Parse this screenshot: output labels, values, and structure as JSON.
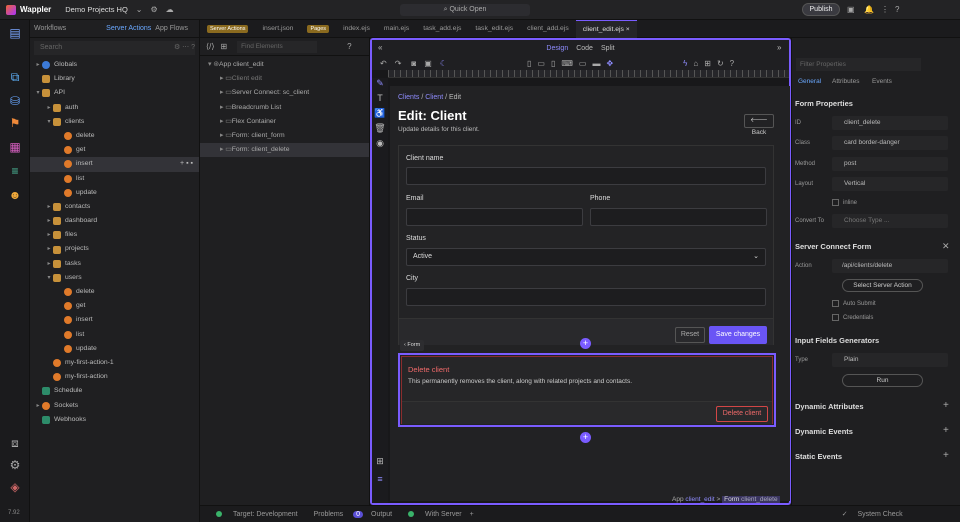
{
  "app": {
    "name": "Wappler",
    "project": "Demo Projects HQ",
    "quick_open": "Quick Open",
    "publish": "Publish"
  },
  "left": {
    "tabs": [
      "Workflows",
      "Server Actions",
      "App Flows"
    ],
    "search_placeholder": "Search",
    "tree": [
      {
        "label": "Globals",
        "depth": 0,
        "icon": "globe",
        "arrow": "right"
      },
      {
        "label": "Library",
        "depth": 0,
        "icon": "folder",
        "arrow": ""
      },
      {
        "label": "API",
        "depth": 0,
        "icon": "folder",
        "arrow": "down"
      },
      {
        "label": "auth",
        "depth": 1,
        "icon": "folder",
        "arrow": "right"
      },
      {
        "label": "clients",
        "depth": 1,
        "icon": "folder",
        "arrow": "down"
      },
      {
        "label": "delete",
        "depth": 2,
        "icon": "sa",
        "arrow": ""
      },
      {
        "label": "get",
        "depth": 2,
        "icon": "sa",
        "arrow": ""
      },
      {
        "label": "insert",
        "depth": 2,
        "icon": "sa",
        "arrow": "",
        "selected": true
      },
      {
        "label": "list",
        "depth": 2,
        "icon": "sa",
        "arrow": ""
      },
      {
        "label": "update",
        "depth": 2,
        "icon": "sa",
        "arrow": ""
      },
      {
        "label": "contacts",
        "depth": 1,
        "icon": "folder",
        "arrow": "right"
      },
      {
        "label": "dashboard",
        "depth": 1,
        "icon": "folder",
        "arrow": "right"
      },
      {
        "label": "files",
        "depth": 1,
        "icon": "folder",
        "arrow": "right"
      },
      {
        "label": "projects",
        "depth": 1,
        "icon": "folder",
        "arrow": "right"
      },
      {
        "label": "tasks",
        "depth": 1,
        "icon": "folder",
        "arrow": "right"
      },
      {
        "label": "users",
        "depth": 1,
        "icon": "folder",
        "arrow": "down"
      },
      {
        "label": "delete",
        "depth": 2,
        "icon": "sa",
        "arrow": ""
      },
      {
        "label": "get",
        "depth": 2,
        "icon": "sa",
        "arrow": ""
      },
      {
        "label": "insert",
        "depth": 2,
        "icon": "sa",
        "arrow": ""
      },
      {
        "label": "list",
        "depth": 2,
        "icon": "sa",
        "arrow": ""
      },
      {
        "label": "update",
        "depth": 2,
        "icon": "sa",
        "arrow": ""
      },
      {
        "label": "my-first-action-1",
        "depth": 1,
        "icon": "sa",
        "arrow": ""
      },
      {
        "label": "my-first-action",
        "depth": 1,
        "icon": "sa",
        "arrow": ""
      },
      {
        "label": "Schedule",
        "depth": 0,
        "icon": "api",
        "arrow": ""
      },
      {
        "label": "Sockets",
        "depth": 0,
        "icon": "sa",
        "arrow": "right"
      },
      {
        "label": "Webhooks",
        "depth": 0,
        "icon": "api",
        "arrow": ""
      }
    ],
    "bottom_number": "7.92"
  },
  "editor_tabs": [
    {
      "label": "Server Actions",
      "badge": true
    },
    {
      "label": "insert.json"
    },
    {
      "label": "Pages",
      "badge": true
    },
    {
      "label": "index.ejs"
    },
    {
      "label": "main.ejs"
    },
    {
      "label": "task_add.ejs"
    },
    {
      "label": "task_edit.ejs"
    },
    {
      "label": "client_add.ejs"
    },
    {
      "label": "client_edit.ejs",
      "active": true
    }
  ],
  "structure": {
    "search_placeholder": "Find Elements",
    "rows": [
      {
        "label": "App client_edit",
        "depth": 0
      },
      {
        "label": "Client edit",
        "depth": 1,
        "dim": true
      },
      {
        "label": "Server Connect: sc_client",
        "depth": 1
      },
      {
        "label": "Breadcrumb List",
        "depth": 1
      },
      {
        "label": "Flex Container",
        "depth": 1
      },
      {
        "label": "Form: client_form",
        "depth": 1
      },
      {
        "label": "Form: client_delete",
        "depth": 1,
        "selected": true
      }
    ]
  },
  "canvas": {
    "modes": [
      "Design",
      "Code",
      "Split"
    ],
    "breadcrumb": [
      "Clients",
      "Client",
      "Edit"
    ],
    "title": "Edit: Client",
    "subtitle": "Update details for this client.",
    "back": "Back",
    "fields": {
      "client_name": "Client name",
      "email": "Email",
      "phone": "Phone",
      "status": "Status",
      "status_value": "Active",
      "city": "City"
    },
    "reset": "Reset",
    "save": "Save changes",
    "form_tag": "Form",
    "danger": {
      "title": "Delete client",
      "text": "This permanently removes the client, along with related projects and contacts.",
      "button": "Delete client"
    },
    "footer": {
      "app": "App",
      "app_name": "client_edit",
      "form": "Form",
      "form_name": "client_delete"
    }
  },
  "props": {
    "search_placeholder": "Filter Properties",
    "tabs": [
      "General",
      "Attributes",
      "Events"
    ],
    "form_properties": "Form Properties",
    "fields": [
      {
        "label": "ID",
        "value": "client_delete"
      },
      {
        "label": "Class",
        "value": "card border-danger"
      },
      {
        "label": "Method",
        "value": "post"
      },
      {
        "label": "Layout",
        "value": "Vertical"
      }
    ],
    "inline": "inline",
    "convert_to": "Convert To",
    "choose_type": "Choose Type ...",
    "server_connect_form": "Server Connect Form",
    "action_label": "Action",
    "action_value": "/api/clients/delete",
    "select_server_action": "Select Server Action",
    "auto_submit": "Auto Submit",
    "credentials": "Credentials",
    "input_generators": "Input Fields Generators",
    "type_label": "Type",
    "type_value": "Plain",
    "run": "Run",
    "dynamic_attributes": "Dynamic Attributes",
    "dynamic_events": "Dynamic Events",
    "static_events": "Static Events"
  },
  "status": {
    "target": "Target: Development",
    "problems": "Problems",
    "problems_count": "0",
    "output": "Output",
    "with_server": "With Server",
    "system_check": "System Check"
  }
}
